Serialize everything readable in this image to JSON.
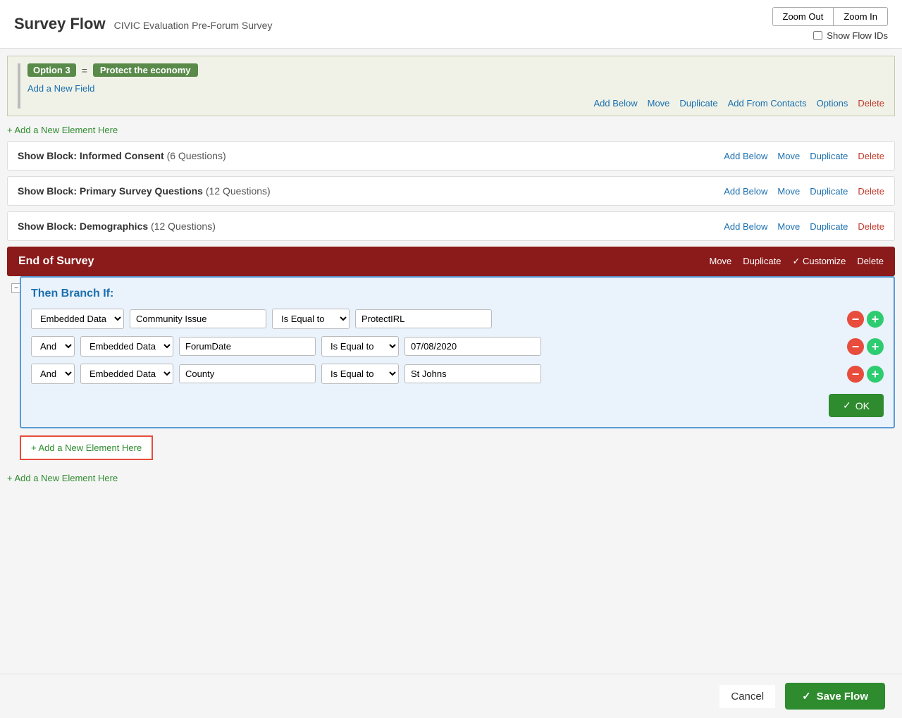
{
  "header": {
    "title": "Survey Flow",
    "subtitle": "CIVIC Evaluation Pre-Forum Survey",
    "zoom_out": "Zoom Out",
    "zoom_in": "Zoom In",
    "show_flow_ids": "Show Flow IDs"
  },
  "top_block": {
    "option_label": "Option 3",
    "equals": "=",
    "protect_label": "Protect the economy",
    "add_field": "Add a New Field",
    "actions": {
      "add_below": "Add Below",
      "move": "Move",
      "duplicate": "Duplicate",
      "add_from_contacts": "Add From Contacts",
      "options": "Options",
      "delete": "Delete"
    }
  },
  "add_element_1": "+ Add a New Element Here",
  "blocks": [
    {
      "label": "Show Block: ",
      "name": "Informed Consent",
      "count": "(6 Questions)",
      "actions": [
        "Add Below",
        "Move",
        "Duplicate",
        "Delete"
      ]
    },
    {
      "label": "Show Block: ",
      "name": "Primary Survey Questions",
      "count": "(12 Questions)",
      "actions": [
        "Add Below",
        "Move",
        "Duplicate",
        "Delete"
      ]
    },
    {
      "label": "Show Block: ",
      "name": "Demographics",
      "count": "(12 Questions)",
      "actions": [
        "Add Below",
        "Move",
        "Duplicate",
        "Delete"
      ]
    }
  ],
  "end_survey": {
    "title": "End of Survey",
    "actions": [
      "Move",
      "Duplicate",
      "Customize",
      "Delete"
    ]
  },
  "branch": {
    "title": "Then Branch If:",
    "rows": [
      {
        "connector": "",
        "connector_type": "first",
        "data_type": "Embedded Data",
        "field": "Community Issue",
        "condition": "Is Equal to",
        "value": "ProtectIRL"
      },
      {
        "connector": "And",
        "connector_type": "and",
        "data_type": "Embedded Data",
        "field": "ForumDate",
        "condition": "Is Equal to",
        "value": "07/08/2020"
      },
      {
        "connector": "And",
        "connector_type": "and",
        "data_type": "Embedded Data",
        "field": "County",
        "condition": "Is Equal to",
        "value": "St Johns"
      }
    ],
    "ok": "OK"
  },
  "add_element_highlighted": "+ Add a New Element Here",
  "add_element_bottom": "+ Add a New Element Here",
  "footer": {
    "cancel": "Cancel",
    "save_flow": "Save Flow"
  }
}
